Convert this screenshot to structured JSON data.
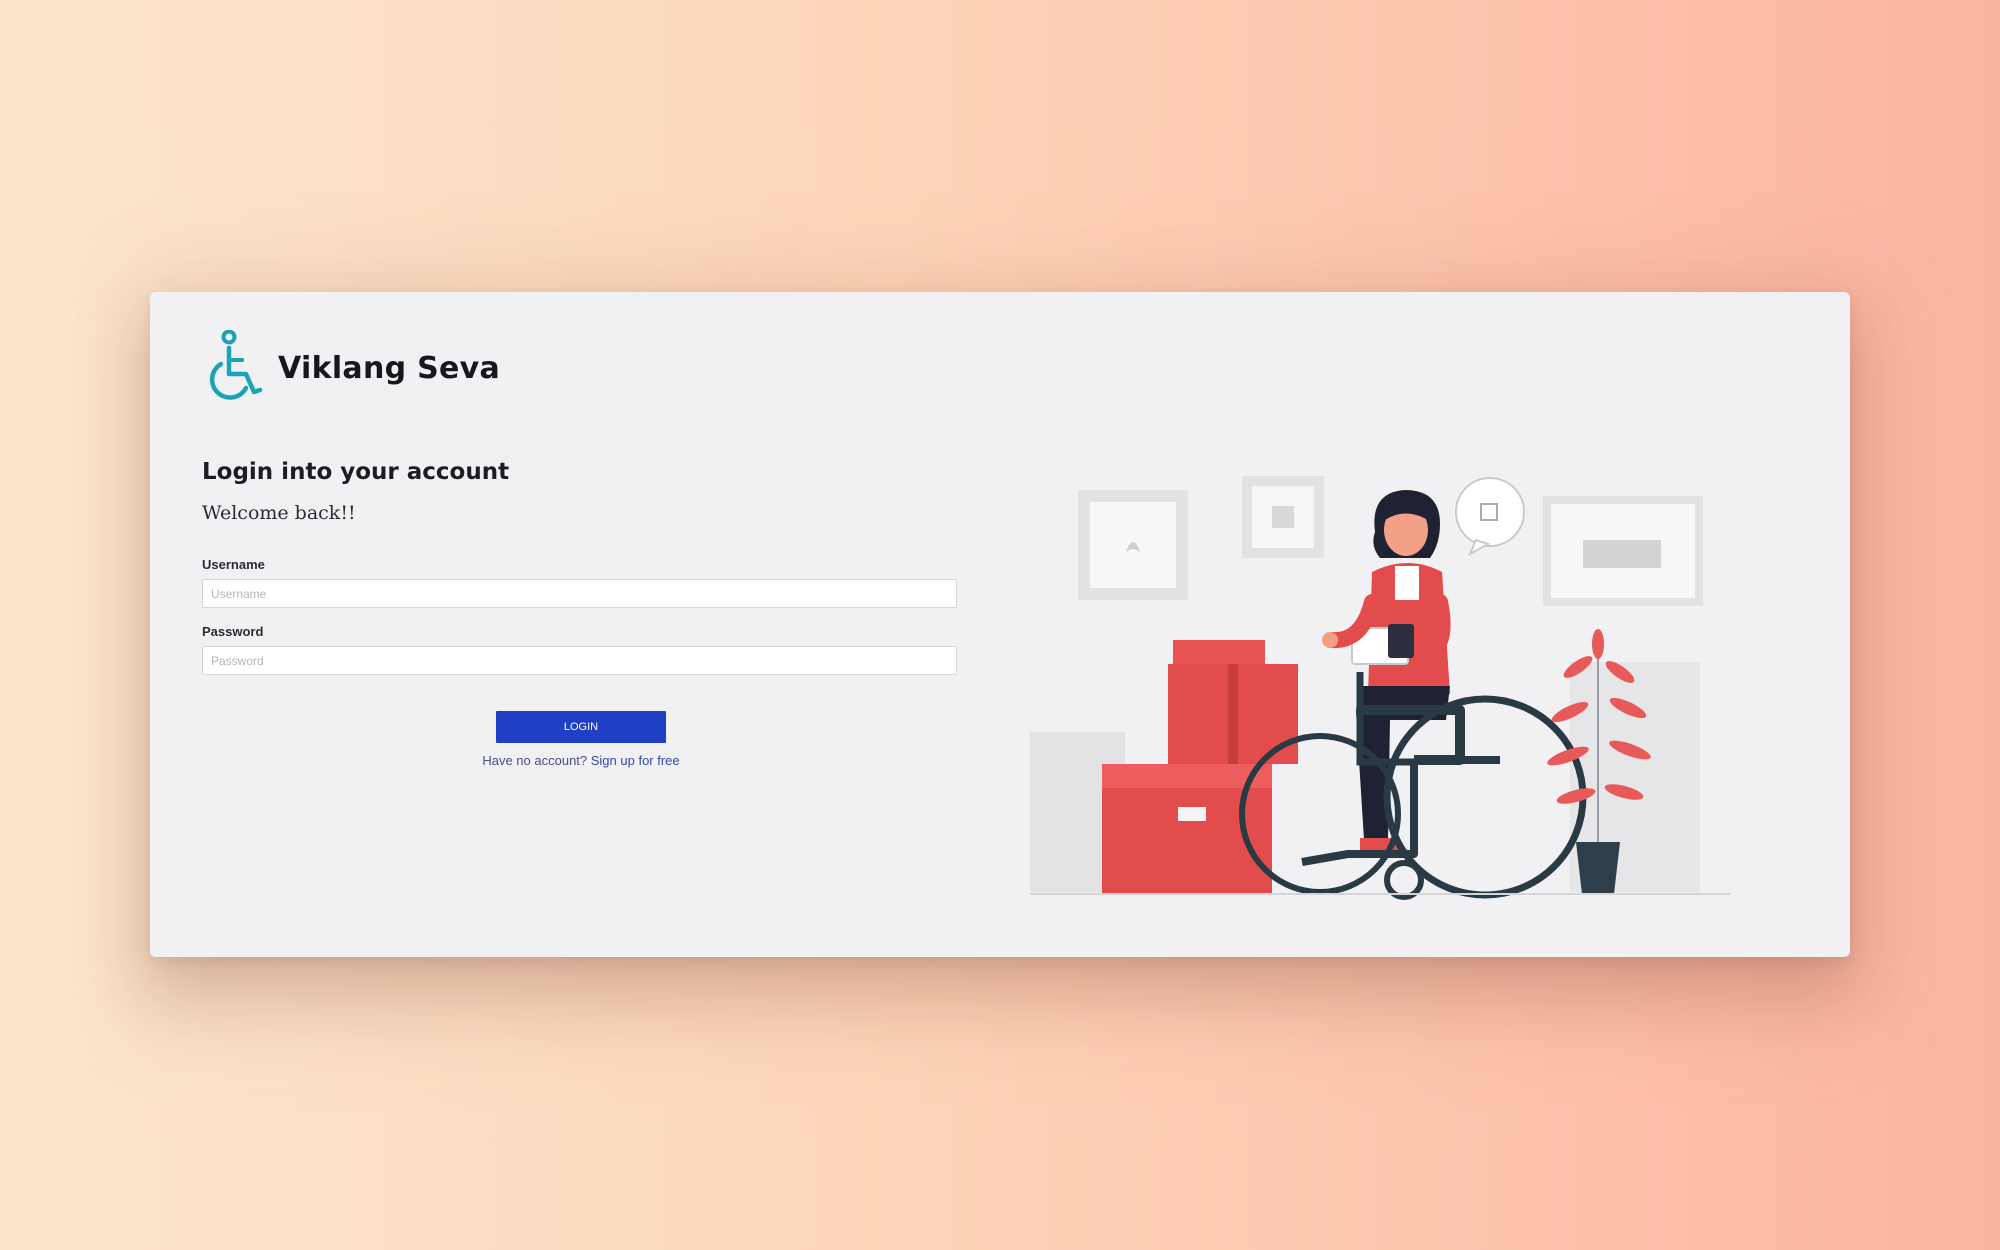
{
  "brand": {
    "name": "Viklang Seva",
    "logo_icon": "wheelchair-icon",
    "accent": "#1aa3b8"
  },
  "login": {
    "heading": "Login into your account",
    "welcome": "Welcome back!!",
    "username_label": "Username",
    "username_placeholder": "Username",
    "password_label": "Password",
    "password_placeholder": "Password",
    "button_label": "LOGIN",
    "signup_prompt": "Have no account? ",
    "signup_link": "Sign up for free"
  },
  "colors": {
    "button": "#1f3fc4",
    "illustration_accent": "#e85a5a",
    "card": "#f1f1f3"
  },
  "illustration": {
    "subject": "person-in-wheelchair-with-boxes"
  }
}
